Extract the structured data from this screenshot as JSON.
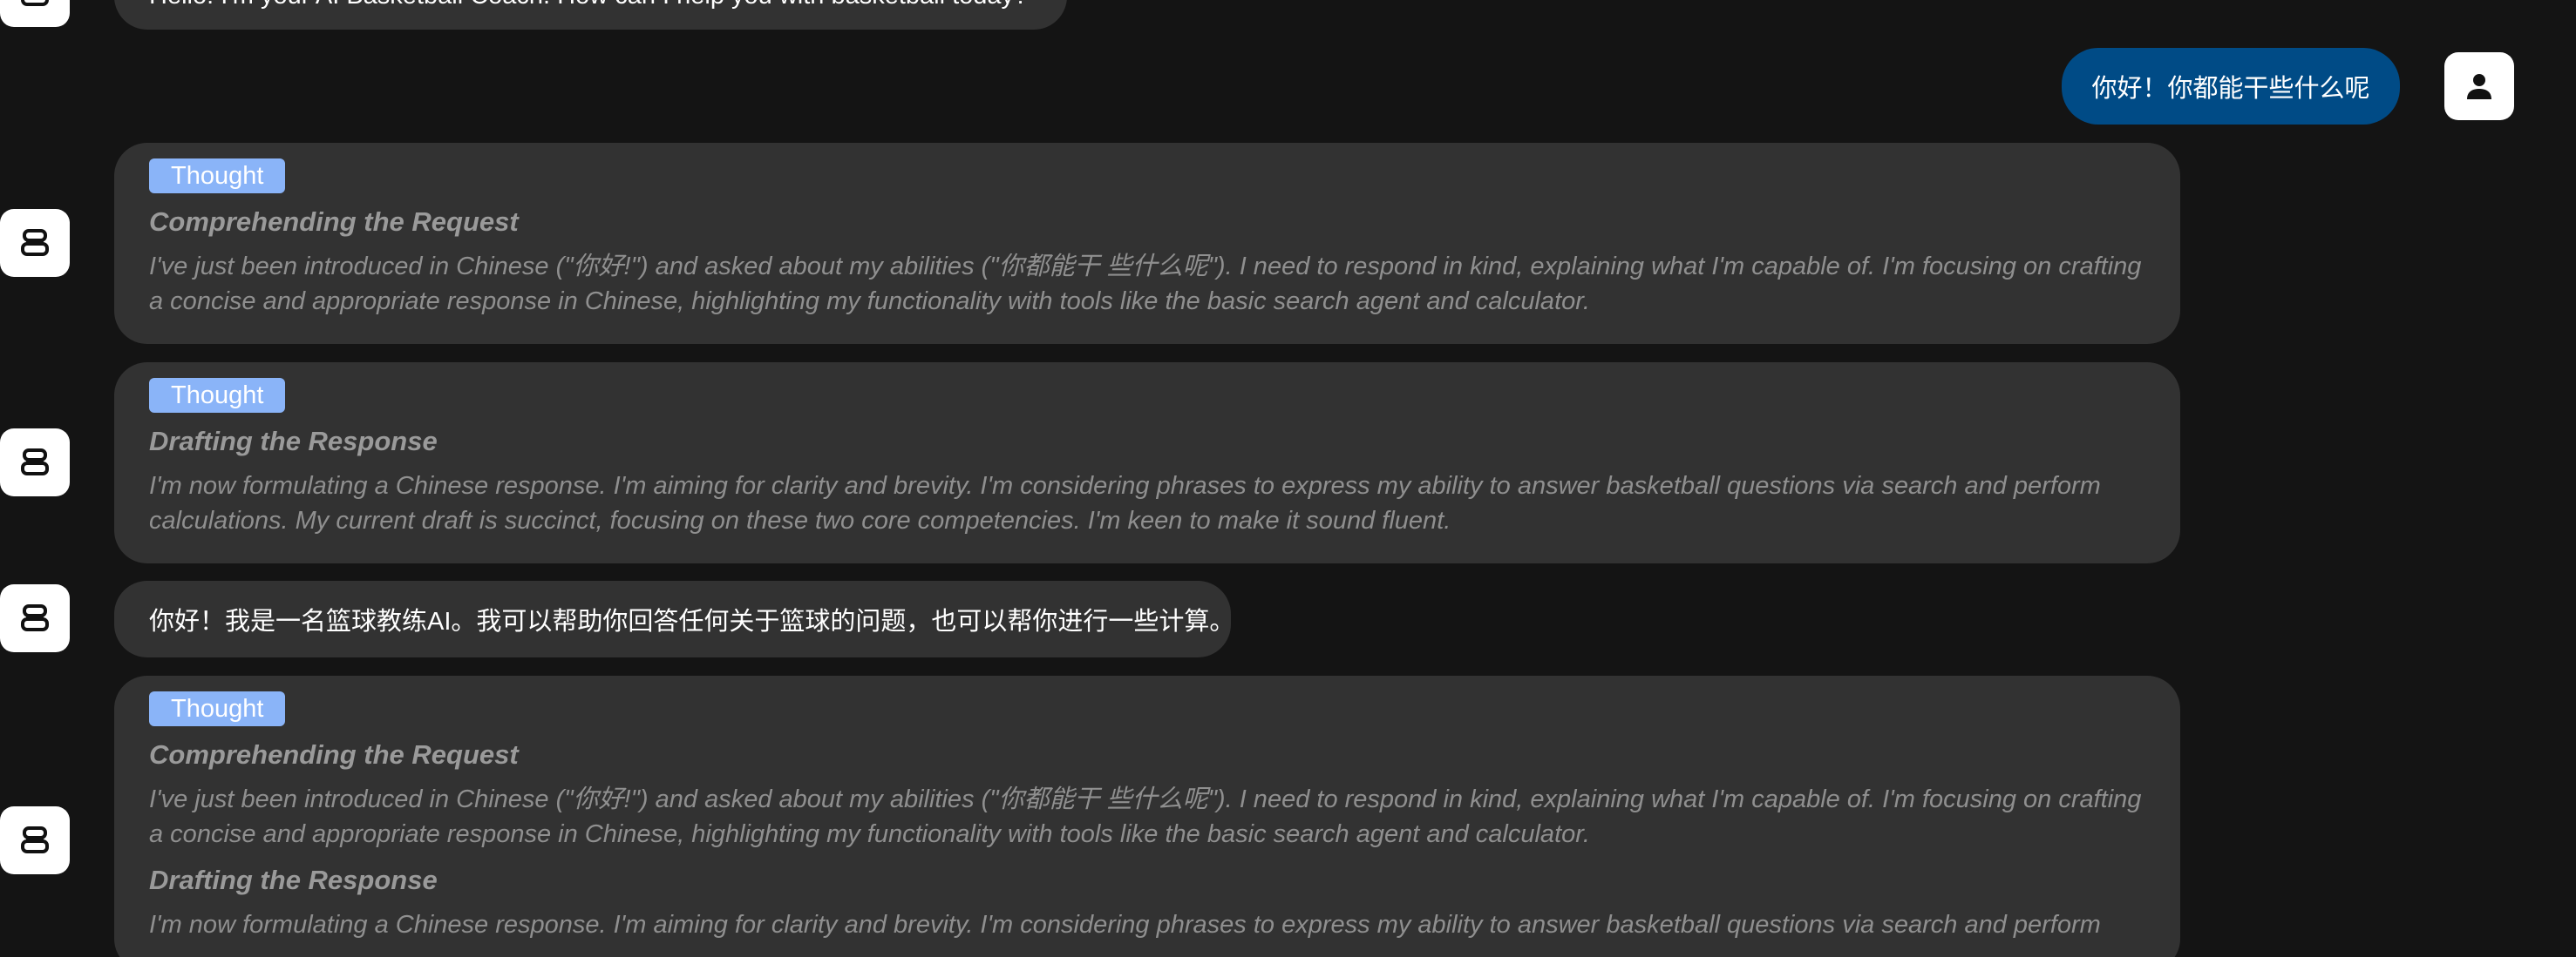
{
  "messages": {
    "greeting": "Hello! I'm your AI Basketball Coach. How can I help you with basketball today?",
    "user_question": "你好！你都能干些什么呢",
    "thought1": {
      "badge": "Thought",
      "title": "Comprehending the Request",
      "body": "I've just been introduced in Chinese (\"你好!\") and asked about my abilities (\"你都能干 些什么呢\"). I need to respond in kind, explaining what I'm capable of. I'm focusing on crafting a concise and appropriate response in Chinese, highlighting my functionality with tools like the basic search agent and calculator."
    },
    "thought2": {
      "badge": "Thought",
      "title": "Drafting the Response",
      "body": "I'm now formulating a Chinese response. I'm aiming for clarity and brevity. I'm considering phrases to express my ability to answer basketball questions via search and perform calculations. My current draft is succinct, focusing on these two core competencies. I'm keen to make it sound fluent."
    },
    "reply": "你好！我是一名篮球教练AI。我可以帮助你回答任何关于篮球的问题，也可以帮你进行一些计算。",
    "thought3": {
      "badge": "Thought",
      "title1": "Comprehending the Request",
      "body1": "I've just been introduced in Chinese (\"你好!\") and asked about my abilities (\"你都能干 些什么呢\"). I need to respond in kind, explaining what I'm capable of. I'm focusing on crafting a concise and appropriate response in Chinese, highlighting my functionality with tools like the basic search agent and calculator.",
      "title2": "Drafting the Response",
      "body2": "I'm now formulating a Chinese response. I'm aiming for clarity and brevity. I'm considering phrases to express my ability to answer basketball questions via search and perform"
    }
  },
  "icons": {
    "bot": "robot-icon",
    "user": "user-icon"
  },
  "colors": {
    "background": "#141414",
    "bubble": "#323232",
    "user_bubble": "#004b86",
    "thought_badge": "#8ab4f8"
  }
}
